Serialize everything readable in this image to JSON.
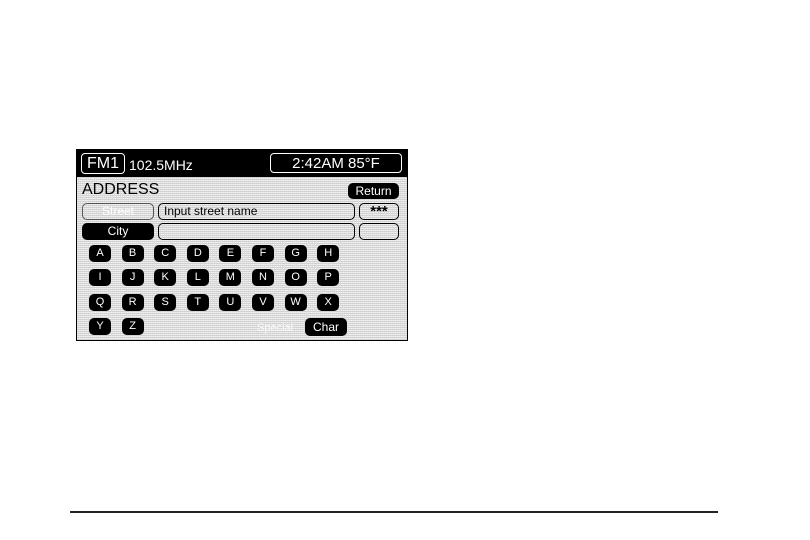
{
  "header": {
    "band": "FM1",
    "frequency": "102.5MHz",
    "clock": "2:42AM 85°F"
  },
  "screen_title": "ADDRESS",
  "buttons": {
    "return": "Return",
    "street": "Street",
    "city": "City",
    "stars": "***",
    "char": "Char",
    "special": "Special"
  },
  "fields": {
    "street_input_placeholder": "Input street name",
    "city_input_value": ""
  },
  "keys": [
    "A",
    "B",
    "C",
    "D",
    "E",
    "F",
    "G",
    "H",
    "I",
    "J",
    "K",
    "L",
    "M",
    "N",
    "O",
    "P",
    "Q",
    "R",
    "S",
    "T",
    "U",
    "V",
    "W",
    "X",
    "Y",
    "Z"
  ]
}
